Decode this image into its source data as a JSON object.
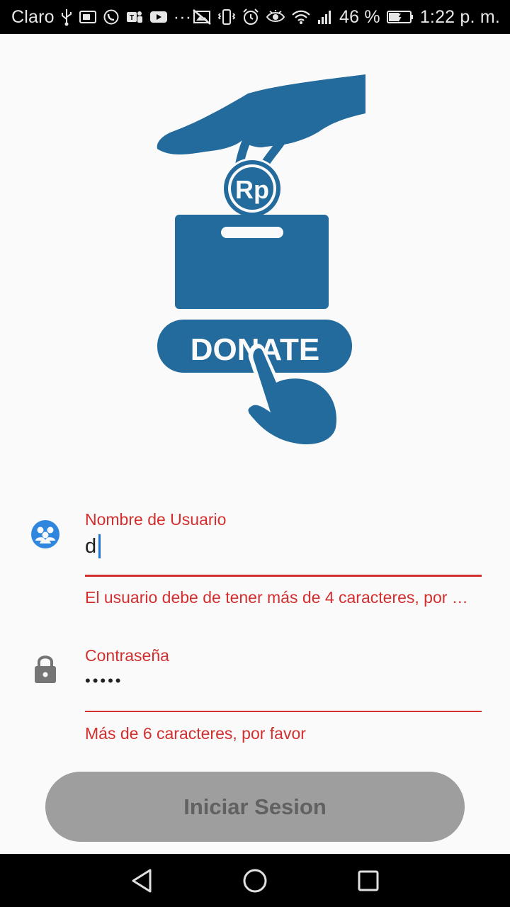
{
  "status_bar": {
    "carrier": "Claro",
    "extra_indicator": "···",
    "battery_percent": "46 %",
    "time": "1:22 p. m.",
    "icons_left": [
      "usb-icon",
      "cast-icon",
      "whatsapp-icon",
      "teams-icon",
      "youtube-icon"
    ],
    "icons_right": [
      "no-image-icon",
      "vibrate-icon",
      "alarm-icon",
      "eye-icon",
      "wifi-icon",
      "signal-icon",
      "battery-icon"
    ]
  },
  "logo": {
    "coin_text": "Rp",
    "button_text": "DONATE",
    "brand_color": "#236a9d"
  },
  "form": {
    "username": {
      "label": "Nombre de Usuario",
      "value": "d",
      "error": "El usuario debe de tener más de 4 caracteres, por …",
      "icon": "users-icon"
    },
    "password": {
      "label": "Contraseña",
      "value_masked": "•••••",
      "error": "Más de 6 caracteres, por favor",
      "icon": "lock-icon"
    },
    "error_color": "#d32f2f",
    "submit_label": "Iniciar Sesion"
  },
  "nav_bar": {
    "buttons": [
      "back-icon",
      "home-icon",
      "recents-icon"
    ]
  }
}
